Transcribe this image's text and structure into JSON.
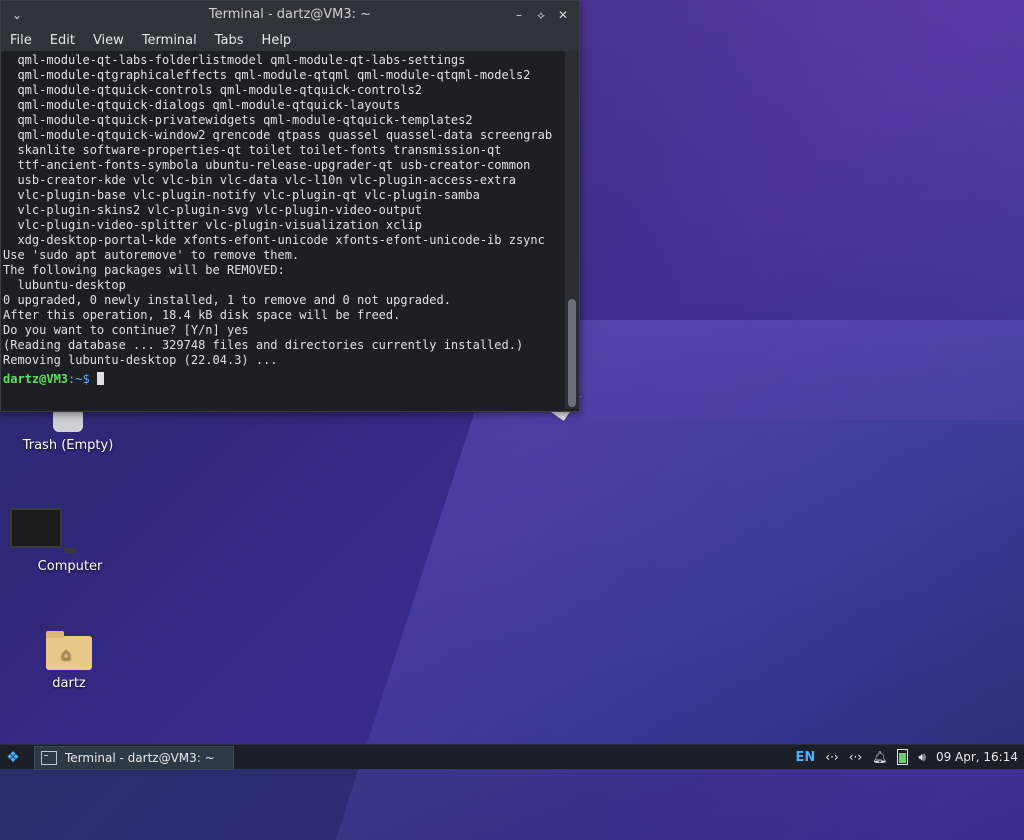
{
  "desktop": {
    "icons": [
      {
        "label": "Trash (Empty)"
      },
      {
        "label": "Computer"
      },
      {
        "label": "dartz"
      }
    ]
  },
  "terminal": {
    "title": "Terminal - dartz@VM3: ~",
    "menu": [
      "File",
      "Edit",
      "View",
      "Terminal",
      "Tabs",
      "Help"
    ],
    "output": "  qml-module-qt-labs-folderlistmodel qml-module-qt-labs-settings\n  qml-module-qtgraphicaleffects qml-module-qtqml qml-module-qtqml-models2\n  qml-module-qtquick-controls qml-module-qtquick-controls2\n  qml-module-qtquick-dialogs qml-module-qtquick-layouts\n  qml-module-qtquick-privatewidgets qml-module-qtquick-templates2\n  qml-module-qtquick-window2 qrencode qtpass quassel quassel-data screengrab\n  skanlite software-properties-qt toilet toilet-fonts transmission-qt\n  ttf-ancient-fonts-symbola ubuntu-release-upgrader-qt usb-creator-common\n  usb-creator-kde vlc vlc-bin vlc-data vlc-l10n vlc-plugin-access-extra\n  vlc-plugin-base vlc-plugin-notify vlc-plugin-qt vlc-plugin-samba\n  vlc-plugin-skins2 vlc-plugin-svg vlc-plugin-video-output\n  vlc-plugin-video-splitter vlc-plugin-visualization xclip\n  xdg-desktop-portal-kde xfonts-efont-unicode xfonts-efont-unicode-ib zsync\nUse 'sudo apt autoremove' to remove them.\nThe following packages will be REMOVED:\n  lubuntu-desktop\n0 upgraded, 0 newly installed, 1 to remove and 0 not upgraded.\nAfter this operation, 18.4 kB disk space will be freed.\nDo you want to continue? [Y/n] yes\n(Reading database ... 329748 files and directories currently installed.)\nRemoving lubuntu-desktop (22.04.3) ...",
    "prompt_user": "dartz@VM3",
    "prompt_path": ":~$ "
  },
  "taskbar": {
    "task_label": "Terminal - dartz@VM3: ~",
    "language": "EN",
    "clock": "09 Apr, 16:14"
  },
  "icons": {
    "start": "start-menu-icon",
    "terminal": "terminal-icon",
    "network": "network-icon",
    "notifications": "bell-icon",
    "battery": "battery-icon",
    "volume": "volume-icon"
  },
  "colors": {
    "prompt_user": "#5be05b",
    "prompt_path": "#6aa6ff",
    "taskbar_accent": "#4fb0ff"
  }
}
